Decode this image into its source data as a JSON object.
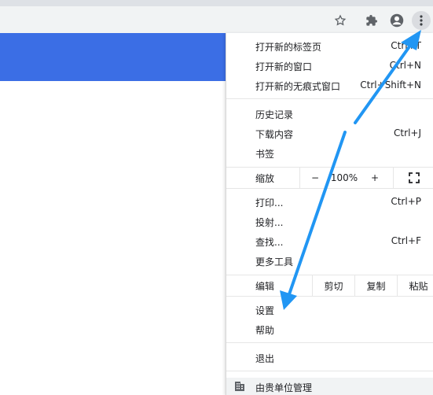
{
  "menu": {
    "section1": [
      {
        "label": "打开新的标签页",
        "shortcut": "Ctrl+T"
      },
      {
        "label": "打开新的窗口",
        "shortcut": "Ctrl+N"
      },
      {
        "label": "打开新的无痕式窗口",
        "shortcut": "Ctrl+Shift+N"
      }
    ],
    "section2": [
      {
        "label": "历史记录",
        "shortcut": ""
      },
      {
        "label": "下载内容",
        "shortcut": "Ctrl+J"
      },
      {
        "label": "书签",
        "shortcut": ""
      }
    ],
    "zoom": {
      "label": "缩放",
      "minus": "−",
      "value": "100%",
      "plus": "+"
    },
    "section3": [
      {
        "label": "打印...",
        "shortcut": "Ctrl+P"
      },
      {
        "label": "投射...",
        "shortcut": ""
      },
      {
        "label": "查找...",
        "shortcut": "Ctrl+F"
      },
      {
        "label": "更多工具",
        "shortcut": ""
      }
    ],
    "edit": {
      "label": "编辑",
      "cut": "剪切",
      "copy": "复制",
      "paste": "粘贴"
    },
    "section4": [
      {
        "label": "设置",
        "shortcut": ""
      },
      {
        "label": "帮助",
        "shortcut": ""
      }
    ],
    "exit": {
      "label": "退出"
    },
    "managed": {
      "label": "由贵单位管理"
    }
  },
  "colors": {
    "accent": "#3b6ee5",
    "annotation_arrow": "#2196f3"
  }
}
